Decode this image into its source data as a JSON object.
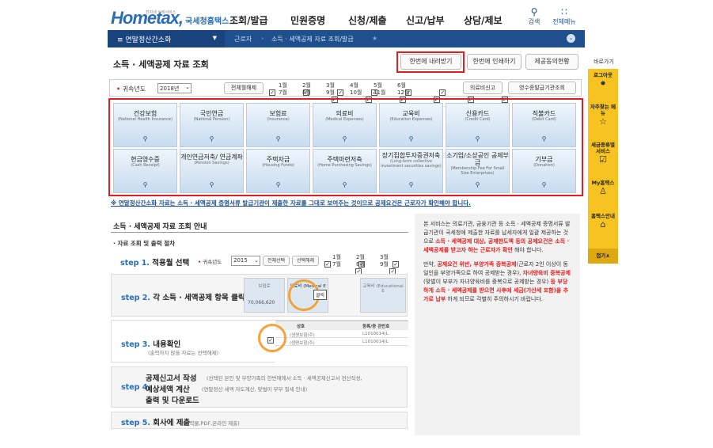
{
  "header": {
    "logo_text": "Hometax,",
    "logo_sub": "국세청홈택스",
    "logo_tiny": "전자세 실례서비스",
    "gnb": [
      "조회/발급",
      "민원증명",
      "신청/제출",
      "신고/납부",
      "상담/제보"
    ],
    "search_label": "검색",
    "allmenu_label": "전체메뉴"
  },
  "navbar": {
    "menu_label": "≡  연말정산간소화",
    "crumb1": "근로자",
    "crumb2": "소득 · 세액공제 자료 조회/발급"
  },
  "page": {
    "title": "소득 · 세액공제 자료 조회",
    "btn_download": "한번에 내려받기",
    "btn_print": "한번에 인쇄하기",
    "btn_consent": "제공동의현황"
  },
  "filter": {
    "year_label": "귀속년도",
    "year_value": "2018년",
    "btn_toggle_all": "전체월해제",
    "months": [
      "1월",
      "2월",
      "3월",
      "4월",
      "5월",
      "6월",
      "7월",
      "8월",
      "9월",
      "10월",
      "11월",
      "12월"
    ],
    "btn_medical": "의료비신고",
    "btn_receipt": "영수증발급기관조회"
  },
  "categories": [
    {
      "k": "건강보험",
      "e": "(National Health Insurance)"
    },
    {
      "k": "국민연금",
      "e": "(National Pension)"
    },
    {
      "k": "보험료",
      "e": "(Insurance)"
    },
    {
      "k": "의료비",
      "e": "(Medical Expenses)"
    },
    {
      "k": "교육비",
      "e": "(Education Expenses)"
    },
    {
      "k": "신용카드",
      "e": "(Credit Card)"
    },
    {
      "k": "직불카드",
      "e": "(Debit Card)"
    },
    {
      "k": "현금영수증",
      "e": "(Cash Receipt)"
    },
    {
      "k": "개인연금저축/ 연금계좌",
      "e": "(Pension Savings)"
    },
    {
      "k": "주택자금",
      "e": "(Housing Funds)"
    },
    {
      "k": "주택마련저축",
      "e": "(Home Purchasing Savings)"
    },
    {
      "k": "장기집합투자증권저축",
      "e": "(Long-term collective investment securities savings)"
    },
    {
      "k": "소기업/소상공인 공제부금",
      "e": "(Membership Fee For Small Size Enterprises)"
    },
    {
      "k": "기부금",
      "e": "(Donation)"
    }
  ],
  "notice": "※ 연말정산간소화 자료는 소득 · 세액공제 증명서류 발급기관이 제출한 자료를 그대로 보여주는 것이므로 공제요건은 근로자가 확인해야 합니다.",
  "guide": {
    "title": "소득 · 세액공제 자료 조회 안내",
    "sub": "· 자료 조회 및 출력 절차",
    "step1_no": "step 1.",
    "step1": "적용월 선택",
    "step1_year_label": "귀속년도",
    "step1_year": "2015",
    "step1_btn1": "전체선택",
    "step1_btn2": "선택해제",
    "step1_months": [
      "1월",
      "2월",
      "3월",
      "7월",
      "8월",
      "9월"
    ],
    "step2_no": "step 2.",
    "step2": "각 소득 · 세액공제 항목 클릭",
    "step2_val": "70,066,620",
    "step2_click": "클릭",
    "step2_cell1": "보험료",
    "step2_cell2": "의료비 (Medical E",
    "step2_cell3": "교육비 (Educational E",
    "step3_no": "step 3.",
    "step3": "내용확인",
    "step3_note": "(출력하지 않을 자료는 선택해제)",
    "step3_col1": "상호",
    "step3_col2": "등록/증 관번호",
    "step3_rows": [
      [
        "(생명보험(주)",
        "L1010014(L"
      ],
      [
        "(생명보험(주)",
        "L1010014(L"
      ]
    ],
    "step4_no": "step 4.",
    "step4_a": "공제신고서 작성",
    "step4_b": "예상세액 계산",
    "step4_c": "출력 및 다운로드",
    "step4_note1": "(선택된 본인 및 부양가족의 한번에에서 소득 · 세액공제신고서 전산작성,",
    "step4_note2": "(연말정산 세액 자도계산, 맞벌이 부부 절세 안내)",
    "step5_no": "step 5.",
    "step5": "회사에 제출",
    "step5_note": "(출력물,PDF,온라인 제출)"
  },
  "sidebox": {
    "p1a": "본 서비스는 의료기관, 금융기관 등 소득 · 세액공제 증명서류 발급기관이 국세청에 제출한 자료를 납세자에게 일괄 제공하는 것으로 ",
    "p1r": "소득 · 세액공제 대상, 공제한도액 등의 공제요건은 소득 · 세액공제를 받고자 하는 근로자가 확인",
    "p1b": " 해야 합니다.",
    "p2a": "만약, ",
    "p2r1": "공제요건 위반, 부양가족 중복공제",
    "p2b": "(근로자 2인 이상이 동일인을 부양가족으로 하여 공제받는 경우), ",
    "p2r2": "자녀양육비 중복공제",
    "p2c": "(맞벌이 부부가 자녀양육비를 중복으로 공제받는 경우) ",
    "p2r3": "등 부당하게 소득 · 세액공제를 받으면 사후에 세금(가산세 포함)을 추가로 납부",
    "p2d": " 하게 되므로 각별히 주의하시기 바랍니다."
  },
  "quickmenu": {
    "back": "바로가기",
    "items": [
      "로그아웃",
      "자주찾는 메뉴",
      "세금종류별 서비스",
      "My홈택스",
      "홈택스안내",
      "접기∧"
    ]
  }
}
